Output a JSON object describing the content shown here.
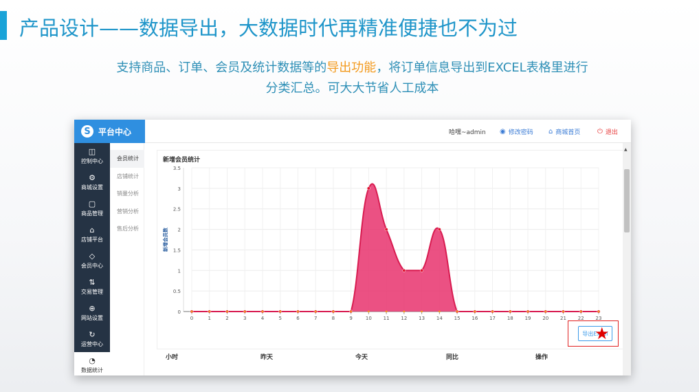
{
  "slide": {
    "title": "产品设计——数据导出，大数据时代再精准便捷也不为过",
    "subtitle_part1": "支持商品、订单、会员及统计数据等的",
    "subtitle_highlight": "导出功能",
    "subtitle_part2": "，将订单信息导出到EXCEL表格里进行",
    "subtitle_line2": "分类汇总。可大大节省人工成本"
  },
  "app": {
    "brand_logo": "S",
    "brand": "平台中心",
    "user": "哈嘿~admin",
    "change_password": "修改密码",
    "shop_home": "商城首页",
    "logout": "退出",
    "sidebar": [
      {
        "icon": "dashboard-icon",
        "glyph": "◫",
        "label": "控制中心"
      },
      {
        "icon": "gear-icon",
        "glyph": "⚙",
        "label": "商城设置"
      },
      {
        "icon": "box-icon",
        "glyph": "▢",
        "label": "商品管理"
      },
      {
        "icon": "store-icon",
        "glyph": "⌂",
        "label": "店铺平台"
      },
      {
        "icon": "diamond-icon",
        "glyph": "◇",
        "label": "会员中心"
      },
      {
        "icon": "transfer-icon",
        "glyph": "⇅",
        "label": "交易管理"
      },
      {
        "icon": "globe-icon",
        "glyph": "⊕",
        "label": "网站设置"
      },
      {
        "icon": "refresh-icon",
        "glyph": "↻",
        "label": "运营中心"
      },
      {
        "icon": "pie-chart-icon",
        "glyph": "◔",
        "label": "数据统计"
      }
    ],
    "subnav": [
      "会员统计",
      "店铺统计",
      "销量分析",
      "营销分析",
      "售后分析"
    ],
    "export_button": "导出Excel",
    "table_headers": [
      "小时",
      "昨天",
      "今天",
      "同比",
      "操作"
    ]
  },
  "chart_data": {
    "type": "area",
    "title": "新增会员统计",
    "ylabel": "新增会员数",
    "xlabel": "",
    "x": [
      0,
      1,
      2,
      3,
      4,
      5,
      6,
      7,
      8,
      9,
      10,
      11,
      12,
      13,
      14,
      15,
      16,
      17,
      18,
      19,
      20,
      21,
      22,
      23
    ],
    "y_ticks": [
      "0",
      "0.5",
      "1",
      "1.5",
      "2",
      "2.5",
      "3",
      "3.5"
    ],
    "ylim": [
      0,
      3.5
    ],
    "series": [
      {
        "values": [
          0,
          0,
          0,
          0,
          0,
          0,
          0,
          0,
          0,
          0,
          3,
          2,
          1,
          1,
          2,
          0,
          0,
          0,
          0,
          0,
          0,
          0,
          0,
          0
        ],
        "color": "#e8336d"
      }
    ],
    "grid": true
  }
}
